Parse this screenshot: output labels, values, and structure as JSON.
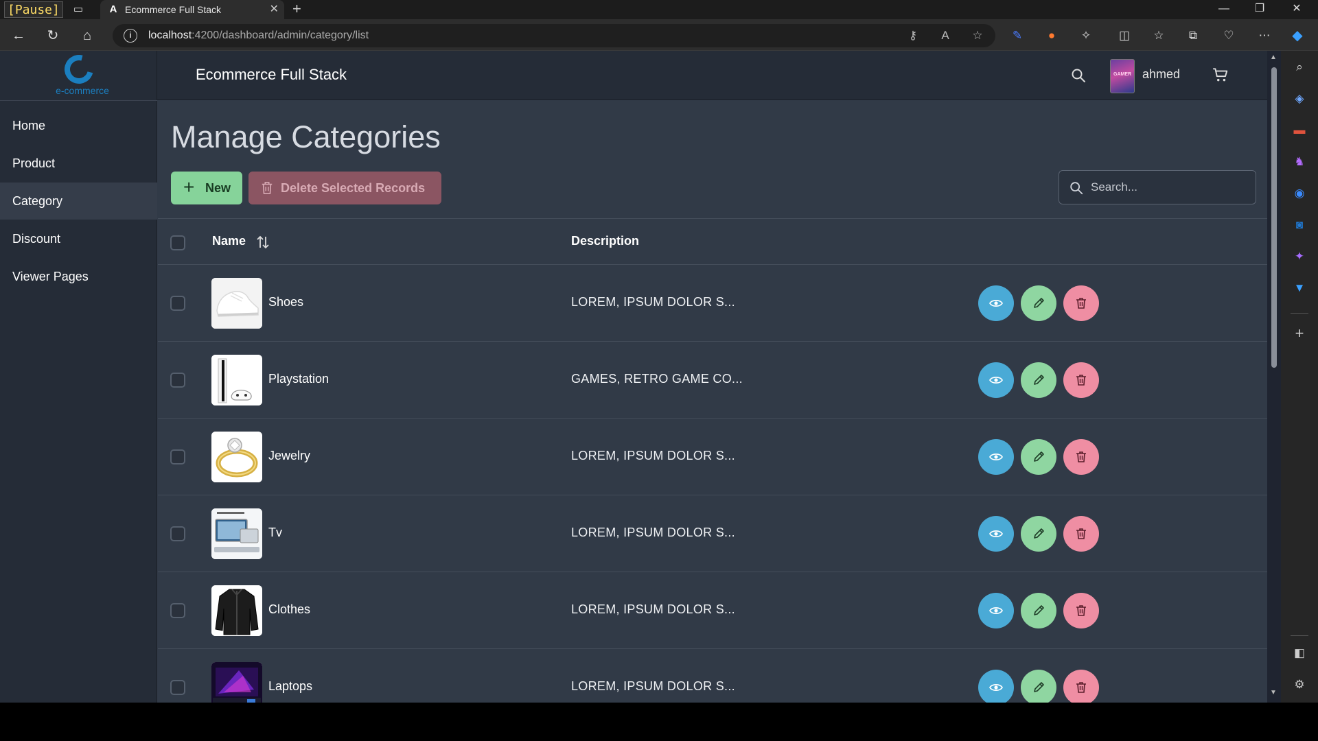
{
  "browser": {
    "pause_badge": "[Pause]",
    "tab_title": "Ecommerce Full Stack",
    "url_host": "localhost",
    "url_rest": ":4200/dashboard/admin/category/list"
  },
  "app": {
    "logo_text": "e-commerce",
    "brand_title": "Ecommerce Full Stack",
    "user_name": "ahmed",
    "avatar_text": "GAMER"
  },
  "sidebar": {
    "items": [
      {
        "label": "Home"
      },
      {
        "label": "Product"
      },
      {
        "label": "Category"
      },
      {
        "label": "Discount"
      },
      {
        "label": "Viewer Pages"
      }
    ],
    "active_index": 2
  },
  "main": {
    "page_title": "Manage Categories",
    "new_button": "New",
    "delete_button": "Delete Selected Records",
    "search_placeholder": "Search..."
  },
  "table": {
    "columns": {
      "name": "Name",
      "description": "Description"
    },
    "rows": [
      {
        "name": "Shoes",
        "description": "LOREM, IPSUM DOLOR S...",
        "thumb": "white-sneaker"
      },
      {
        "name": "Playstation",
        "description": "GAMES, RETRO GAME CO...",
        "thumb": "playstation-console"
      },
      {
        "name": "Jewelry",
        "description": "LOREM, IPSUM DOLOR S...",
        "thumb": "gold-ring"
      },
      {
        "name": "Tv",
        "description": "LOREM, IPSUM DOLOR S...",
        "thumb": "tv-screen"
      },
      {
        "name": "Clothes",
        "description": "LOREM, IPSUM DOLOR S...",
        "thumb": "black-jacket"
      },
      {
        "name": "Laptops",
        "description": "LOREM, IPSUM DOLOR S...",
        "thumb": "gaming-laptop"
      }
    ]
  },
  "colors": {
    "page_bg": "#313a47",
    "sidebar_bg": "#252c37",
    "new_button": "#86d39a",
    "delete_button": "#8b5562",
    "view_action": "#4aaad6",
    "edit_action": "#8fd6a1",
    "delete_action": "#ef8ea3",
    "brand": "#1b7fc0"
  }
}
